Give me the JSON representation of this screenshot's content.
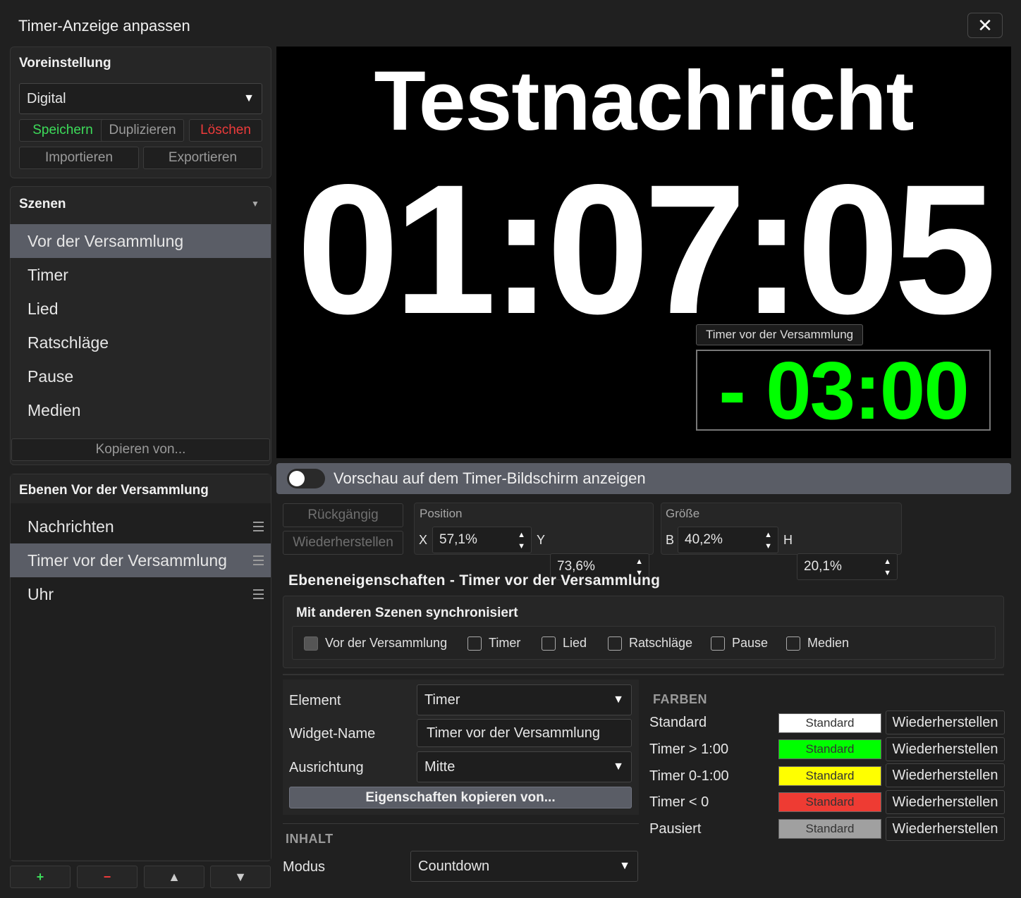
{
  "window": {
    "title": "Timer-Anzeige anpassen",
    "close_glyph": "✕"
  },
  "preset": {
    "heading": "Voreinstellung",
    "selected": "Digital",
    "save": "Speichern",
    "duplicate": "Duplizieren",
    "delete": "Löschen",
    "import": "Importieren",
    "export": "Exportieren"
  },
  "scenes": {
    "heading": "Szenen",
    "items": [
      "Vor der Versammlung",
      "Timer",
      "Lied",
      "Ratschläge",
      "Pause",
      "Medien"
    ],
    "copy_from": "Kopieren von..."
  },
  "layers": {
    "heading": "Ebenen Vor der Versammlung",
    "items": [
      "Nachrichten",
      "Timer vor der Versammlung",
      "Uhr"
    ],
    "add": "+",
    "remove": "−",
    "up": "▲",
    "down": "▼"
  },
  "preview": {
    "message": "Testnachricht",
    "clock": "01:07:05",
    "timer_label": "Timer vor der Versammlung",
    "timer_value": "- 03:00"
  },
  "preview_toggle": {
    "label": "Vorschau auf dem Timer-Bildschirm anzeigen"
  },
  "edit": {
    "undo": "Rückgängig",
    "redo": "Wiederherstellen"
  },
  "position": {
    "label": "Position",
    "x_label": "X",
    "x": "57,1%",
    "y_label": "Y",
    "y": "73,6%"
  },
  "size": {
    "label": "Größe",
    "w_label": "B",
    "w": "40,2%",
    "h_label": "H",
    "h": "20,1%"
  },
  "layer_props": {
    "heading": "Ebeneneigenschaften - Timer vor der Versammlung",
    "sync_heading": "Mit anderen Szenen synchronisiert",
    "sync_items": [
      "Vor der Versammlung",
      "Timer",
      "Lied",
      "Ratschläge",
      "Pause",
      "Medien"
    ]
  },
  "form": {
    "element_label": "Element",
    "element_value": "Timer",
    "widget_label": "Widget-Name",
    "widget_value": "Timer vor der Versammlung",
    "align_label": "Ausrichtung",
    "align_value": "Mitte",
    "copy_props": "Eigenschaften kopieren von...",
    "content_heading": "INHALT",
    "mode_label": "Modus",
    "mode_value": "Countdown"
  },
  "colors": {
    "heading": "FARBEN",
    "rows": [
      {
        "label": "Standard",
        "swatch": "Standard",
        "color": "#ffffff",
        "text_color": "#333333",
        "reset": "Wiederherstellen"
      },
      {
        "label": "Timer > 1:00",
        "swatch": "Standard",
        "color": "#00ff00",
        "text_color": "#333333",
        "reset": "Wiederherstellen"
      },
      {
        "label": "Timer 0-1:00",
        "swatch": "Standard",
        "color": "#ffff00",
        "text_color": "#333333",
        "reset": "Wiederherstellen"
      },
      {
        "label": "Timer < 0",
        "swatch": "Standard",
        "color": "#ee3b33",
        "text_color": "#333333",
        "reset": "Wiederherstellen"
      },
      {
        "label": "Pausiert",
        "swatch": "Standard",
        "color": "#a0a0a0",
        "text_color": "#333333",
        "reset": "Wiederherstellen"
      }
    ]
  },
  "accent": {
    "green": "#3ddc5a",
    "red": "#ee3b3b",
    "timer_green": "#00ff00"
  }
}
